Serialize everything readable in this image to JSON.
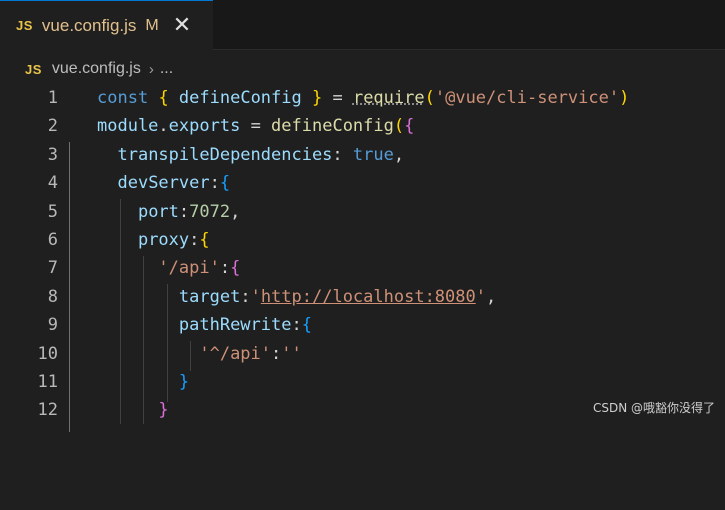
{
  "tab": {
    "icon_label": "JS",
    "icon": "js-file-icon",
    "filename": "vue.config.js",
    "modified_badge": "M",
    "close_icon": "close-icon"
  },
  "breadcrumb": {
    "icon_label": "JS",
    "file": "vue.config.js",
    "separator": "›",
    "more": "..."
  },
  "editor": {
    "lines": [
      {
        "n": "1"
      },
      {
        "n": "2"
      },
      {
        "n": "3"
      },
      {
        "n": "4"
      },
      {
        "n": "5"
      },
      {
        "n": "6"
      },
      {
        "n": "7"
      },
      {
        "n": "8"
      },
      {
        "n": "9"
      },
      {
        "n": "10"
      },
      {
        "n": "11"
      },
      {
        "n": "12"
      }
    ],
    "tokens": {
      "l1": [
        "const",
        " ",
        "{",
        " defineConfig ",
        "}",
        " = ",
        "require",
        "(",
        "'@vue/cli-service'",
        ")"
      ],
      "l2": [
        "module",
        ".",
        "exports",
        " = ",
        "defineConfig",
        "(",
        "{"
      ],
      "l3": [
        "transpileDependencies",
        ": ",
        "true",
        ","
      ],
      "l4": [
        "devServer",
        ":",
        "{"
      ],
      "l5": [
        "port",
        ":",
        "7072",
        ","
      ],
      "l6": [
        "proxy",
        ":",
        "{"
      ],
      "l7": [
        "'/api'",
        ":",
        "{"
      ],
      "l8": [
        "target",
        ":",
        "'",
        "http://localhost:8080",
        "'",
        ","
      ],
      "l9": [
        "pathRewrite",
        ":",
        "{"
      ],
      "l10": [
        "'^/api'",
        ":",
        "''"
      ],
      "l11": [
        "}"
      ],
      "l12": [
        "}"
      ]
    }
  },
  "colors": {
    "keyword": "#569cd6",
    "variable": "#9cdcfe",
    "function": "#dcdcaa",
    "string": "#ce9178",
    "number": "#b5cea8",
    "bracket_level1": "#ffd700",
    "bracket_level2": "#da70d6",
    "bracket_level3": "#179fff",
    "tab_accent": "#0078d4"
  },
  "watermark": "CSDN @哦豁你没得了"
}
